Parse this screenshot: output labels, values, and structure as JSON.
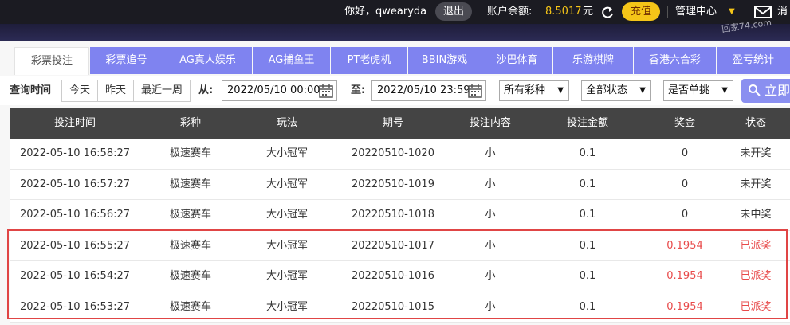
{
  "topbar": {
    "greeting": "你好，qwearyda",
    "logout": "退出",
    "balance_label": "账户余额:",
    "balance_value": "8.5017",
    "balance_unit": "元",
    "recharge": "充值",
    "management": "管理中心",
    "message": "消",
    "watermark": "回家74.com",
    "accent_color": "#f5c518"
  },
  "tabs": [
    {
      "label": "彩票投注",
      "active": true
    },
    {
      "label": "彩票追号"
    },
    {
      "label": "AG真人娱乐"
    },
    {
      "label": "AG捕鱼王"
    },
    {
      "label": "PT老虎机"
    },
    {
      "label": "BBIN游戏"
    },
    {
      "label": "沙巴体育"
    },
    {
      "label": "乐游棋牌"
    },
    {
      "label": "香港六合彩"
    },
    {
      "label": "盈亏统计"
    }
  ],
  "filter": {
    "query_time_label": "查询时间",
    "today": "今天",
    "yesterday": "昨天",
    "last_week": "最近一周",
    "from_label": "从:",
    "from_value": "2022/05/10 00:00",
    "to_label": "至:",
    "to_value": "2022/05/10 23:59",
    "lottery_select": "所有彩种",
    "status_select": "全部状态",
    "single_select": "是否单挑",
    "query_button": "立即"
  },
  "table": {
    "headers": [
      "投注时间",
      "彩种",
      "玩法",
      "期号",
      "投注内容",
      "投注金额",
      "奖金",
      "状态"
    ],
    "rows": [
      [
        "2022-05-10 16:58:27",
        "极速赛车",
        "大小冠军",
        "20220510-1020",
        "小",
        "0.1",
        "0",
        "未开奖"
      ],
      [
        "2022-05-10 16:57:27",
        "极速赛车",
        "大小冠军",
        "20220510-1019",
        "小",
        "0.1",
        "0",
        "未开奖"
      ],
      [
        "2022-05-10 16:56:27",
        "极速赛车",
        "大小冠军",
        "20220510-1018",
        "小",
        "0.1",
        "0",
        "未中奖"
      ],
      [
        "2022-05-10 16:55:27",
        "极速赛车",
        "大小冠军",
        "20220510-1017",
        "小",
        "0.1",
        "0.1954",
        "已派奖"
      ],
      [
        "2022-05-10 16:54:27",
        "极速赛车",
        "大小冠军",
        "20220510-1016",
        "小",
        "0.1",
        "0.1954",
        "已派奖"
      ],
      [
        "2022-05-10 16:53:27",
        "极速赛车",
        "大小冠军",
        "20220510-1015",
        "小",
        "0.1",
        "0.1954",
        "已派奖"
      ]
    ],
    "paid_color": "#e84a4a",
    "highlight_color": "#e04545"
  }
}
